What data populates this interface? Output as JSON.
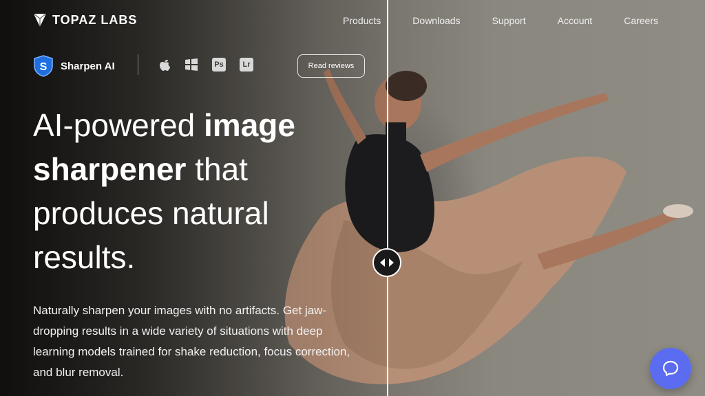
{
  "brand": {
    "name": "TOPAZ LABS"
  },
  "nav": [
    "Products",
    "Downloads",
    "Support",
    "Account",
    "Careers"
  ],
  "product": {
    "name": "Sharpen AI",
    "platforms": [
      {
        "name": "apple-icon"
      },
      {
        "name": "windows-icon"
      },
      {
        "name": "photoshop-icon",
        "label": "Ps"
      },
      {
        "name": "lightroom-icon",
        "label": "Lr"
      }
    ],
    "reviews_button": "Read reviews"
  },
  "hero": {
    "part1": "AI-powered ",
    "bold1": "image sharpener",
    "part2": " that produces natural results."
  },
  "description": "Naturally sharpen your images with no artifacts. Get jaw-dropping results in a wide variety of situations with deep learning models trained for shake reduction, focus correction, and blur removal.",
  "colors": {
    "accent": "#5b6cf0",
    "divider": "#ffffff"
  }
}
